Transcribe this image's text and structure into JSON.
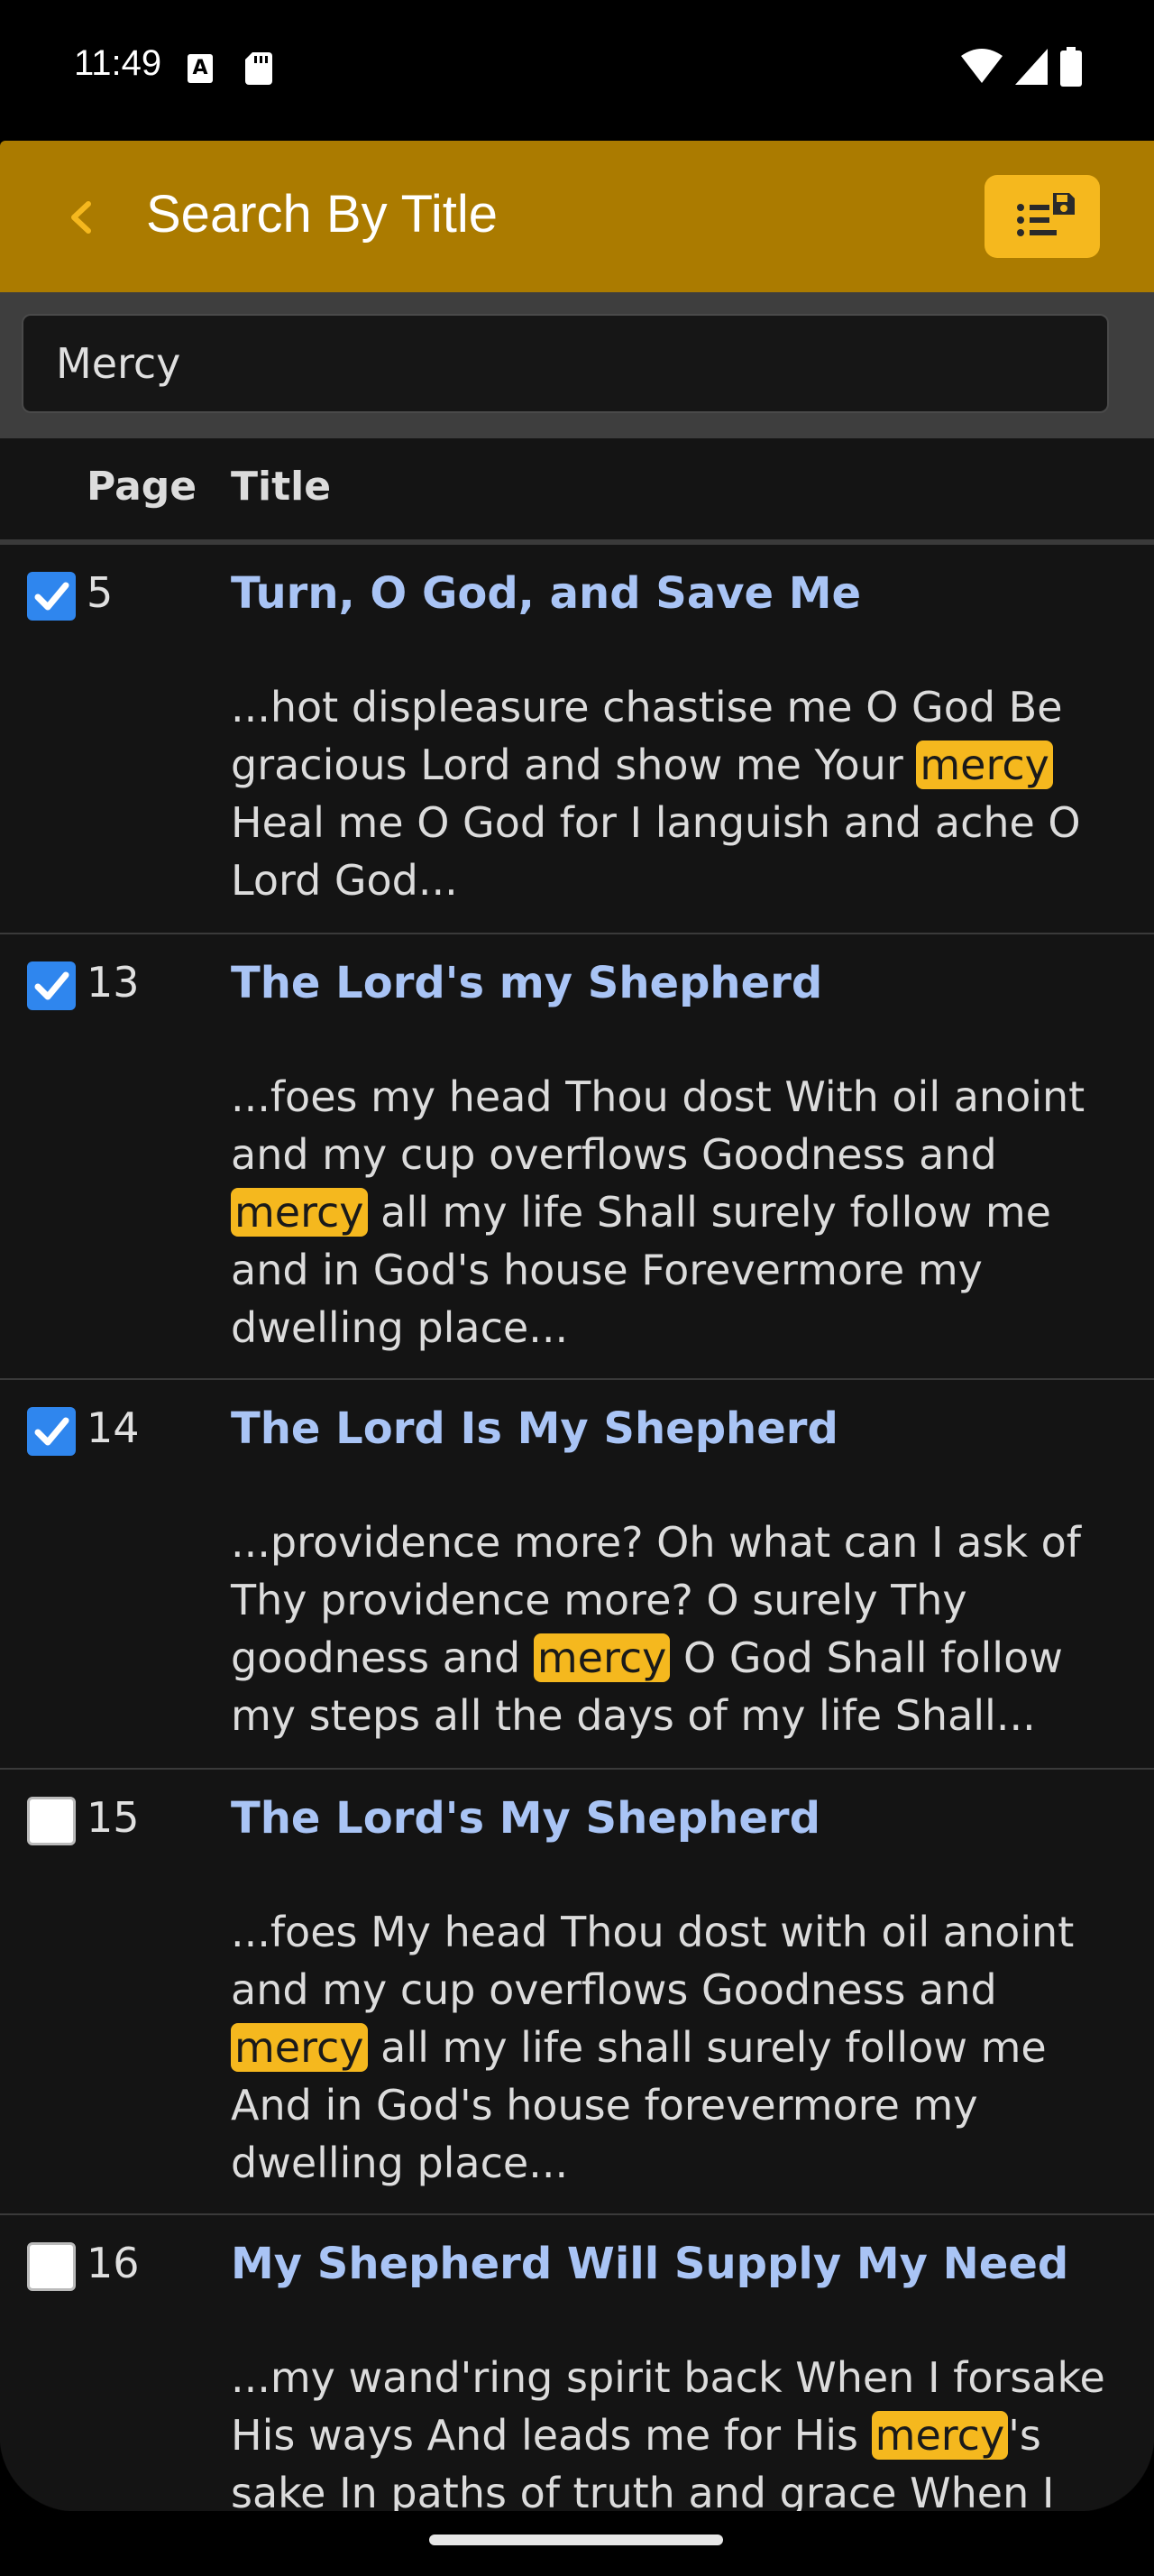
{
  "status": {
    "time": "11:49",
    "a_badge": "A"
  },
  "header": {
    "title": "Search By Title"
  },
  "search": {
    "value": "Mercy"
  },
  "table": {
    "col_page": "Page",
    "col_title": "Title"
  },
  "rows": [
    {
      "checked": true,
      "page": "5",
      "title": "Turn, O God, and Save Me",
      "pre": "...hot displeasure chastise me O God Be gracious Lord and show me Your ",
      "hl": "mercy",
      "post": " Heal me O God for I languish and ache O Lord God..."
    },
    {
      "checked": true,
      "page": "13",
      "title": "The Lord's my Shepherd",
      "pre": "...foes my head Thou dost With oil anoint and my cup overflows Goodness and ",
      "hl": "mercy",
      "post": " all my life Shall surely follow me and in God's house Forevermore my dwelling place..."
    },
    {
      "checked": true,
      "page": "14",
      "title": "The Lord Is My Shepherd",
      "pre": "...providence more? Oh what can I ask of Thy providence more? O surely Thy goodness and ",
      "hl": "mercy",
      "post": " O God Shall follow my steps all the days of my life Shall..."
    },
    {
      "checked": false,
      "page": "15",
      "title": "The Lord's My Shepherd",
      "pre": "...foes My head Thou dost with oil anoint and my cup overflows Goodness and ",
      "hl": "mercy",
      "post": " all my life shall surely follow me And in God's house forevermore my dwelling place..."
    },
    {
      "checked": false,
      "page": "16",
      "title": "My Shepherd Will Supply My Need",
      "pre": "...my wand'ring spirit back When I forsake His ways And leads me for His ",
      "hl": "mercy",
      "post": "'s sake In paths of truth and grace When I walk"
    }
  ],
  "colors": {
    "appbar": "#ab7b00",
    "accent": "#f5b81e",
    "checkbox": "#2f86ee",
    "title_link": "#a9c4f5"
  }
}
